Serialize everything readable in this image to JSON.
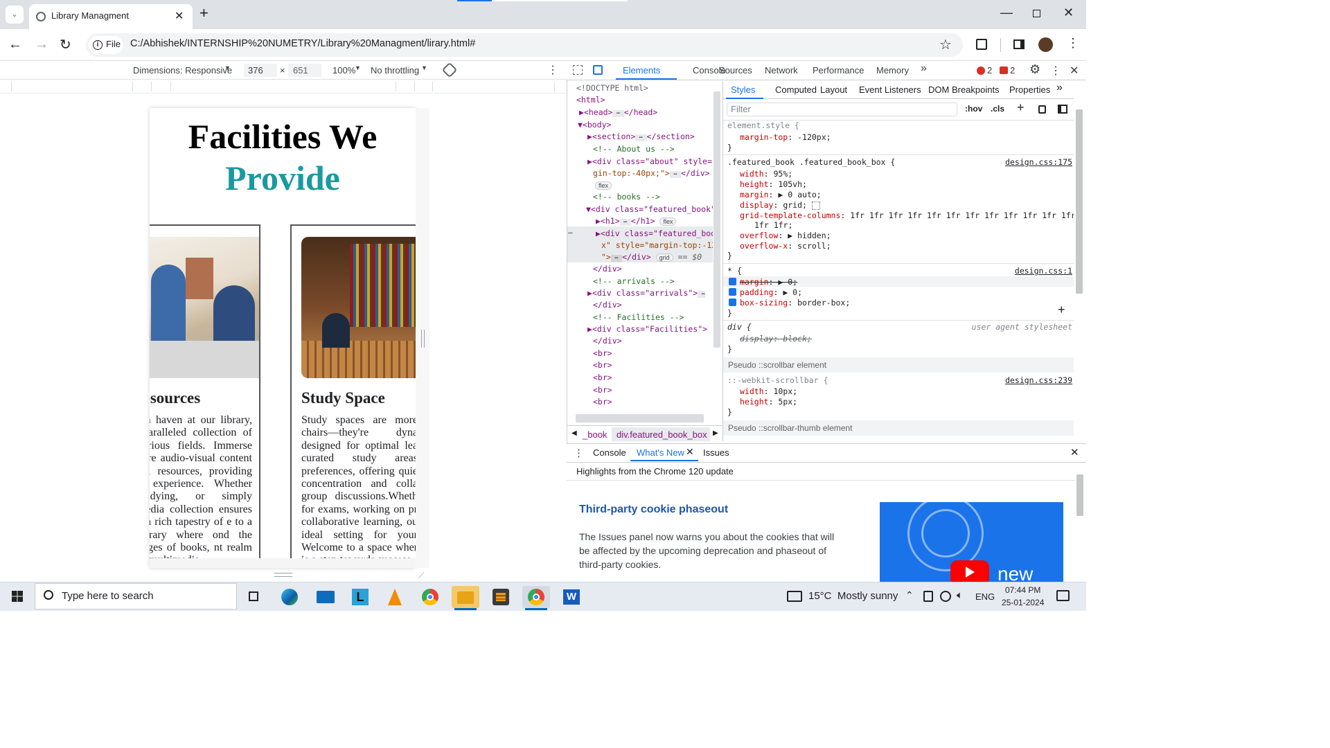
{
  "browser": {
    "tab_title": "Library Managment",
    "address_scheme": "File",
    "address": "C:/Abhishek/INTERNSHIP%20NUMETRY/Library%20Managment/lirary.html#"
  },
  "device_toolbar": {
    "dimensions": "Dimensions: Responsive",
    "width": "376",
    "times": "×",
    "height": "651",
    "zoom": "100%",
    "throttle": "No throttling"
  },
  "page": {
    "heading_line1": "Facilities We",
    "heading_line2": "Provide",
    "accent": "#1a9aa0",
    "cards": [
      {
        "title": "Resources",
        "text": "dia haven at our library, nparalleled collection of various fields. Immerse here audio-visual content nal resources, providing g experience. Whether studying, or simply media collection ensures o a rich tapestry of e to a library where ond the pages of books, nt realm of multimedia"
      },
      {
        "title": "Study Space",
        "text": "Study spaces are more chairs—they're dyna designed for optimal lea curated study areas preferences, offering quie concentration and colla group discussions.Wheth for exams, working on pr collaborative learning, ou ideal setting for your Welcome to a space wher is a step towards success."
      }
    ]
  },
  "devtools": {
    "tabs": [
      "Elements",
      "Console",
      "Sources",
      "Network",
      "Performance",
      "Memory"
    ],
    "more": "»",
    "errors": "2",
    "warnings": "2",
    "dom": {
      "doctype": "<!DOCTYPE html>",
      "html": "<html>",
      "head": "<head>",
      "head_close": "</head>",
      "body": "<body>",
      "section": "<section>",
      "section_close": "</section>",
      "c_about": "<!--  About us -->",
      "div_about_a": "<div class=\"about\" style=\"",
      "div_about_b": "gin-top:-40px;\">",
      "div_close": "</div>",
      "pill_flex": "flex",
      "c_books": "<!-- books -->",
      "div_featured": "<div class=\"featured_book\"",
      "h1": "<h1>",
      "h1_close": "</h1>",
      "div_fb_a": "<div class=\"featured_boo",
      "div_fb_b": "x\" style=\"margin-top:-12",
      "div_fb_c": "\">",
      "pill_grid": "grid",
      "eq": "== $0",
      "c_arrivals": "<!--    arrivals  -->",
      "div_arrivals": "<div class=\"arrivals\">",
      "c_facilities": "<!-- Facilities -->",
      "div_facilities": "<div class=\"Facilities\">",
      "br": "<br>"
    },
    "crumb1": "_book",
    "crumb2": "div.featured_book_box",
    "styles_tabs": [
      "Styles",
      "Computed",
      "Layout",
      "Event Listeners",
      "DOM Breakpoints",
      "Properties"
    ],
    "filter_placeholder": "Filter",
    "hov": ":hov",
    "cls": ".cls",
    "rules": {
      "el_sel": "element.style {",
      "el_p1": "margin-top",
      "el_v1": "-120px;",
      "fb_sel": ".featured_book .featured_book_box {",
      "fb_src": "design.css:175",
      "fb_props": [
        {
          "p": "width",
          "v": "95%;"
        },
        {
          "p": "height",
          "v": "105vh;"
        },
        {
          "p": "margin",
          "v": "▶ 0 auto;"
        },
        {
          "p": "display",
          "v": "grid;"
        },
        {
          "p": "grid-template-columns",
          "v": "1fr 1fr 1fr 1fr 1fr 1fr 1fr 1fr 1fr 1fr 1fr 1fr"
        },
        {
          "p": "",
          "v": "1fr 1fr;"
        },
        {
          "p": "overflow",
          "v": "▶ hidden;"
        },
        {
          "p": "overflow-x",
          "v": "scroll;"
        }
      ],
      "star_sel": "* {",
      "star_src": "design.css:1",
      "star_props": [
        {
          "p": "margin",
          "v": "▶ 0;"
        },
        {
          "p": "padding",
          "v": "▶ 0;"
        },
        {
          "p": "box-sizing",
          "v": "border-box;"
        }
      ],
      "div_sel": "div {",
      "div_src": "user agent stylesheet",
      "div_prop": "display: block;",
      "pseudo1": "Pseudo ::scrollbar element",
      "sb_sel": "::-webkit-scrollbar {",
      "sb_src": "design.css:239",
      "sb_props": [
        {
          "p": "width",
          "v": "10px;"
        },
        {
          "p": "height",
          "v": "5px;"
        }
      ],
      "pseudo2": "Pseudo ::scrollbar-thumb element",
      "close": "}"
    },
    "drawer": {
      "tabs": [
        "Console",
        "What's New",
        "Issues"
      ],
      "highlights": "Highlights from the Chrome 120 update",
      "headline": "Third-party cookie phaseout",
      "body": "The Issues panel now warns you about the cookies that will be affected by the upcoming deprecation and phaseout of third-party cookies.",
      "video_label": "new"
    }
  },
  "taskbar": {
    "search_placeholder": "Type here to search",
    "weather": "15°C  Mostly sunny",
    "lang": "ENG",
    "time": "07:44 PM",
    "date": "25-01-2024"
  }
}
